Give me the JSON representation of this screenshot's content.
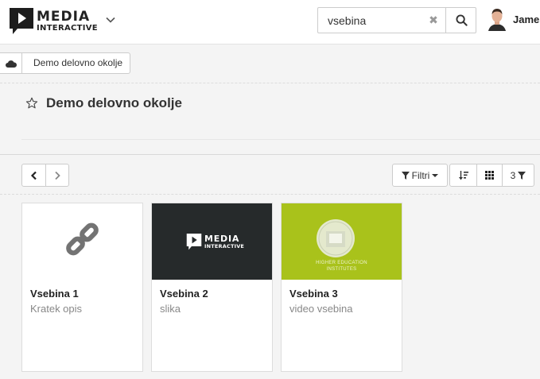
{
  "header": {
    "logo_line1": "MEDIA",
    "logo_line2": "INTERACTIVE",
    "search_value": "vsebina",
    "user_name": "James"
  },
  "breadcrumb": {
    "items": [
      "Demo delovno okolje"
    ]
  },
  "page": {
    "title": "Demo delovno okolje"
  },
  "toolbar": {
    "filter_label": "Filtri",
    "filter_count": "3"
  },
  "cards": [
    {
      "title": "Vsebina 1",
      "subtitle": "Kratek opis",
      "thumb": "link-icon"
    },
    {
      "title": "Vsebina 2",
      "subtitle": "slika",
      "thumb": "media-interactive-logo",
      "thumb_logo_line1": "MEDIA",
      "thumb_logo_line2": "INTERACTIVE"
    },
    {
      "title": "Vsebina 3",
      "subtitle": "video vsebina",
      "thumb": "higher-education-institutes-logo",
      "thumb_text_line1": "HIGHER EDUCATION",
      "thumb_text_line2": "INSTITUTES"
    }
  ],
  "colors": {
    "thumb_dark": "#262a2b",
    "thumb_green": "#a9c21b"
  }
}
